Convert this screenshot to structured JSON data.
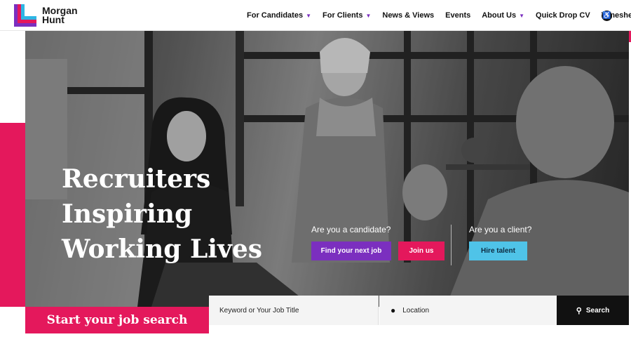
{
  "brand": {
    "line1": "Morgan",
    "line2": "Hunt"
  },
  "nav": [
    {
      "label": "For Candidates",
      "dropdown": true
    },
    {
      "label": "For Clients",
      "dropdown": true
    },
    {
      "label": "News & Views",
      "dropdown": false
    },
    {
      "label": "Events",
      "dropdown": false
    },
    {
      "label": "About Us",
      "dropdown": true
    },
    {
      "label": "Quick Drop CV",
      "dropdown": false
    },
    {
      "label": "Timesheets",
      "dropdown": true
    }
  ],
  "accessibility_icon": "accessibility-icon",
  "hero": {
    "headline": [
      "Recruiters",
      "Inspiring",
      "Working Lives"
    ],
    "candidate_question": "Are you a candidate?",
    "client_question": "Are you a client?",
    "find_job": "Find your next job",
    "join": "Join us",
    "hire": "Hire talent"
  },
  "search": {
    "heading": "Start your job search",
    "keyword_placeholder": "Keyword or Your Job Title",
    "location_placeholder": "Location",
    "button": "Search"
  },
  "colors": {
    "purple": "#7b2fbf",
    "pink": "#e4185c",
    "blue": "#4fc3e8",
    "black": "#111111"
  }
}
